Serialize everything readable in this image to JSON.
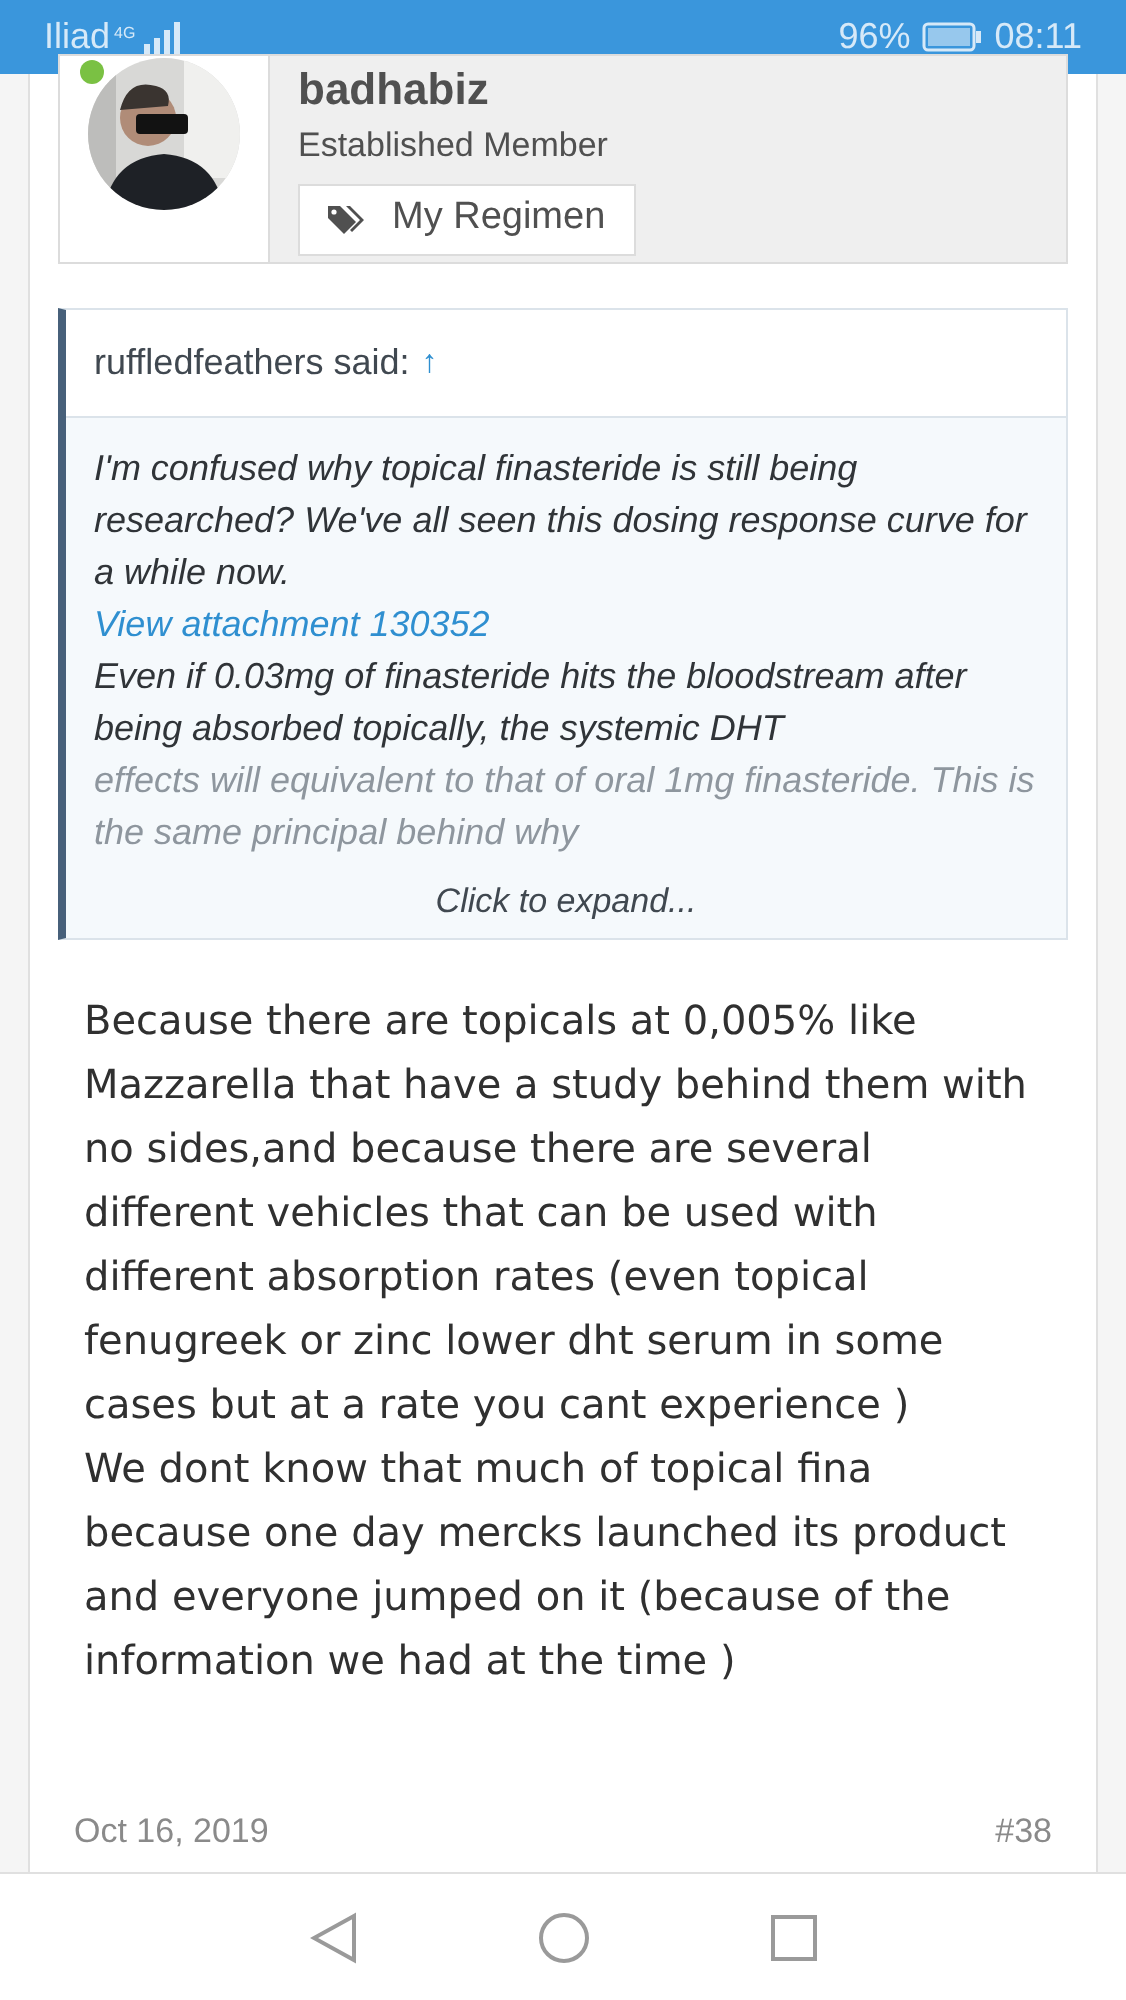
{
  "status_bar": {
    "carrier": "Iliad",
    "network": "4G",
    "battery": "96%",
    "time": "08:11"
  },
  "author": {
    "name": "badhabiz",
    "online": true,
    "title": "Established Member",
    "regimen_button": "My Regimen"
  },
  "quote": {
    "author": "ruffledfeathers said:",
    "jump": "↑",
    "text": "I'm confused why topical finasteride is still being researched? We've all seen this dosing response curve for a while now.",
    "attachment": "View attachment 130352",
    "text_2": "Even if 0.03mg of finasteride hits the bloodstream after being absorbed topically, the systemic DHT",
    "text_faded": "effects will equivalent to that of oral 1mg finasteride. This is the same principal behind why",
    "expand": "Click to expand..."
  },
  "body": [
    "Because there are topicals at 0,005% like Mazzarella that have a study behind them with no sides,and because there are several different vehicles that can be used with different absorption rates (even topical fenugreek or zinc lower dht serum in some cases but at a rate you cant experience )",
    "We dont know that much of topical fina because one day mercks launched its product and everyone jumped on it (because of the information we had at the time )"
  ],
  "footer": {
    "date": "Oct 16, 2019",
    "post_number": "#38"
  }
}
